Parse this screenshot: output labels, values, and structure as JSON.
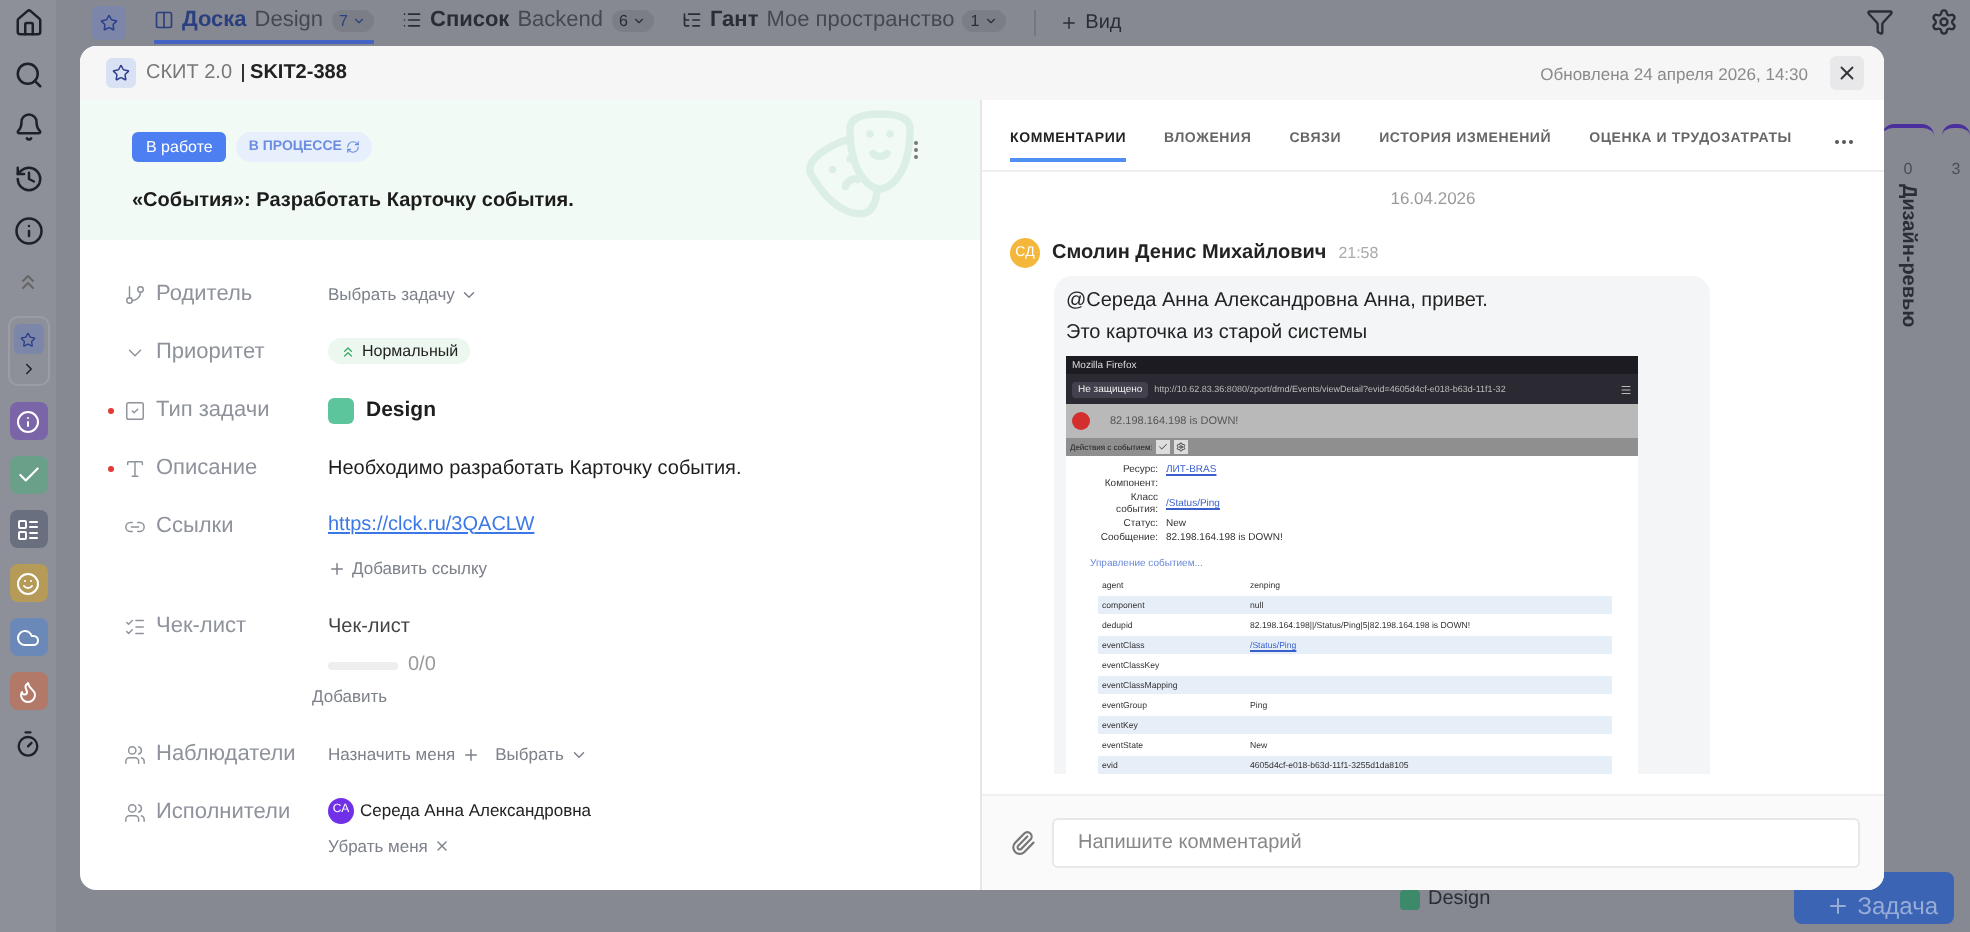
{
  "nav": {
    "tabs": [
      {
        "kind": "board",
        "view": "Доска",
        "space": "Design",
        "count": "7",
        "selected": true
      },
      {
        "kind": "list",
        "view": "Список",
        "space": "Backend",
        "count": "6",
        "selected": false
      },
      {
        "kind": "gantt",
        "view": "Гант",
        "space": "Мое пространство",
        "count": "1",
        "selected": false
      }
    ],
    "add_view": "Вид"
  },
  "board": {
    "columns": [
      {
        "count": "0",
        "title": "Дизайн-ревью"
      },
      {
        "count": "3"
      }
    ],
    "card_type": "Design",
    "add_task": "Задача"
  },
  "modal": {
    "project": "СКИТ 2.0",
    "key": "SKIT2-388",
    "updated": "Обновлена 24 апреля 2026, 14:30",
    "status": "В работе",
    "stage": "В ПРОЦЕССЕ",
    "title": "«События»: Разработать Карточку события.",
    "fields": [
      {
        "kind": "select",
        "label": "Родитель",
        "required": false,
        "value": "Выбрать задачу"
      },
      {
        "kind": "priority",
        "label": "Приоритет",
        "required": false,
        "value": "Нормальный"
      },
      {
        "kind": "type",
        "label": "Тип задачи",
        "required": true,
        "value": "Design"
      },
      {
        "kind": "text",
        "label": "Описание",
        "required": true,
        "value": "Необходимо разработать Карточку события."
      },
      {
        "kind": "links",
        "label": "Ссылки",
        "required": false,
        "links": [
          "https://clck.ru/3QACLW"
        ],
        "action": "Добавить ссылку"
      },
      {
        "kind": "checklist",
        "label": "Чек-лист",
        "required": false,
        "title": "Чек-лист",
        "level": 0,
        "progress": "0/0",
        "action": "Добавить"
      },
      {
        "kind": "watchers",
        "label": "Наблюдатели",
        "required": false,
        "assign": "Назначить меня",
        "pick": "Выбрать"
      },
      {
        "kind": "assignees",
        "label": "Исполнители",
        "required": false,
        "people": [
          {
            "initials": "СА",
            "name": "Середа Анна Александровна"
          }
        ],
        "action": "Убрать меня"
      }
    ],
    "tabs": [
      {
        "label": "КОММЕНТАРИИ",
        "selected": true
      },
      {
        "label": "ВЛОЖЕНИЯ",
        "selected": false
      },
      {
        "label": "СВЯЗИ",
        "selected": false
      },
      {
        "label": "ИСТОРИЯ ИЗМЕНЕНИЙ",
        "selected": false
      },
      {
        "label": "ОЦЕНКА И ТРУДОЗАТРАТЫ",
        "selected": false
      }
    ],
    "date": "16.04.2026",
    "comments": [
      {
        "initials": "СД",
        "author": "Смолин Денис Михайлович",
        "time": "21:58",
        "lines": [
          "@Середа Анна Александровна Анна, привет.",
          "Это карточка из старой системы"
        ],
        "attachment": {
          "window_title": "Mozilla Firefox",
          "security": "Не защищено",
          "url": "http://10.62.83.36:8080/zport/dmd/Events/viewDetail?evid=4605d4cf-e018-b63d-11f1-32",
          "alert": "82.198.164.198 is DOWN!",
          "actions_label": "Действия с событием:",
          "details": [
            {
              "label": "Ресурс:",
              "value": "ЛИТ-BRAS",
              "link": true
            },
            {
              "label": "Компонент:"
            },
            {
              "label": "Класс события:",
              "value": "/Status/Ping",
              "link": true
            },
            {
              "label": "Статус:",
              "value": "New",
              "link": false
            },
            {
              "label": "Сообщение:",
              "value": "82.198.164.198 is DOWN!",
              "link": false
            }
          ],
          "manage_link": "Управление событием...",
          "rows": [
            {
              "key": "agent",
              "value": "zenping",
              "link": false
            },
            {
              "key": "component",
              "value": "null",
              "link": false
            },
            {
              "key": "dedupid",
              "value": "82.198.164.198||/Status/Ping|5|82.198.164.198 is DOWN!",
              "link": false
            },
            {
              "key": "eventClass",
              "value": "/Status/Ping",
              "link": true
            },
            {
              "key": "eventClassKey"
            },
            {
              "key": "eventClassMapping"
            },
            {
              "key": "eventGroup",
              "value": "Ping",
              "link": false
            },
            {
              "key": "eventKey"
            },
            {
              "key": "eventState",
              "value": "New",
              "link": false
            },
            {
              "key": "evid",
              "value": "4605d4cf-e018-b63d-11f1-3255d1da8105",
              "link": false
            }
          ]
        }
      }
    ],
    "composer": {
      "placeholder": "Напишите комментарий"
    }
  }
}
